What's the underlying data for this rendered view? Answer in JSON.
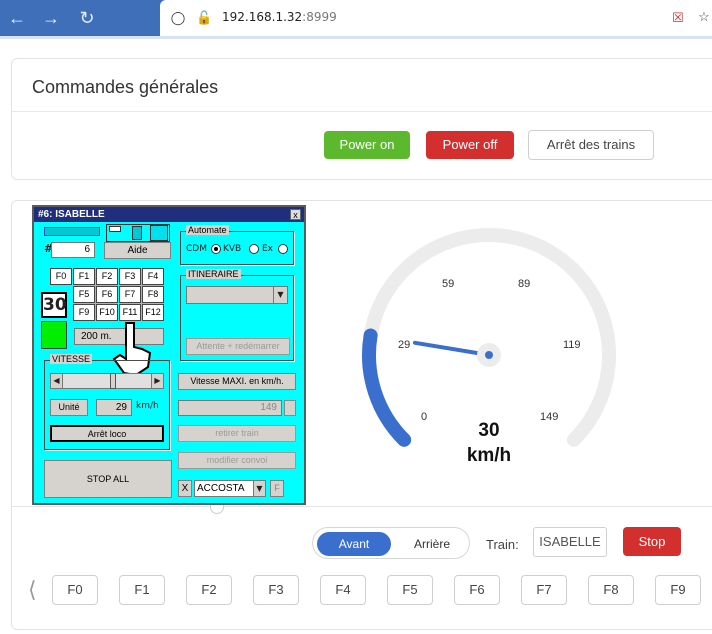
{
  "browser": {
    "url_host": "192.168.1.32",
    "url_port": ":8999"
  },
  "general": {
    "title": "Commandes générales",
    "power_on": "Power on",
    "power_off": "Power off",
    "stop_trains": "Arrêt des trains"
  },
  "gauge": {
    "ticks": [
      "0",
      "29",
      "59",
      "89",
      "119",
      "149"
    ],
    "value": "30",
    "unit": "km/h",
    "speed_value": 30,
    "speed_max": 149,
    "colors": {
      "fill": "#3b6fce",
      "track": "#ececec",
      "needle": "#3b6fce"
    }
  },
  "drive": {
    "forward": "Avant",
    "backward": "Arrière",
    "train_label": "Train:",
    "train_name": "ISABELLE",
    "stop": "Stop"
  },
  "fkeys": [
    "F0",
    "F1",
    "F2",
    "F3",
    "F4",
    "F5",
    "F6",
    "F7",
    "F8",
    "F9"
  ],
  "popup": {
    "title": "#6: ISABELLE",
    "close": "x",
    "hash": "#",
    "number": "6",
    "aide": "Aide",
    "f_row1": [
      "F0",
      "F1",
      "F2",
      "F3",
      "F4"
    ],
    "f_row2": [
      "F5",
      "F6",
      "F7",
      "F8"
    ],
    "f_row3": [
      "F9",
      "F10",
      "F11",
      "F12"
    ],
    "speed_box": "30",
    "distance": "200 m.",
    "vitesse_label": "VITESSE",
    "unite": "Unité",
    "speed_field": "29",
    "speed_unit": "km/h",
    "arret_loco": "Arrêt loco",
    "stop_all": "STOP ALL",
    "automate_label": "Automate",
    "radio_cdm": "CDM",
    "radio_kvb": "KVB",
    "radio_ex": "Ex",
    "itineraire_label": "ITINERAIRE",
    "attente": "Attente + redémarrer",
    "vitesse_maxi": "Vitesse MAXI. en km/h.",
    "maxi_value": "149",
    "retirer": "retirer train",
    "modifier": "modifier convoi",
    "x_btn": "X",
    "accosta": "ACCOSTA",
    "f_btn": "F"
  }
}
